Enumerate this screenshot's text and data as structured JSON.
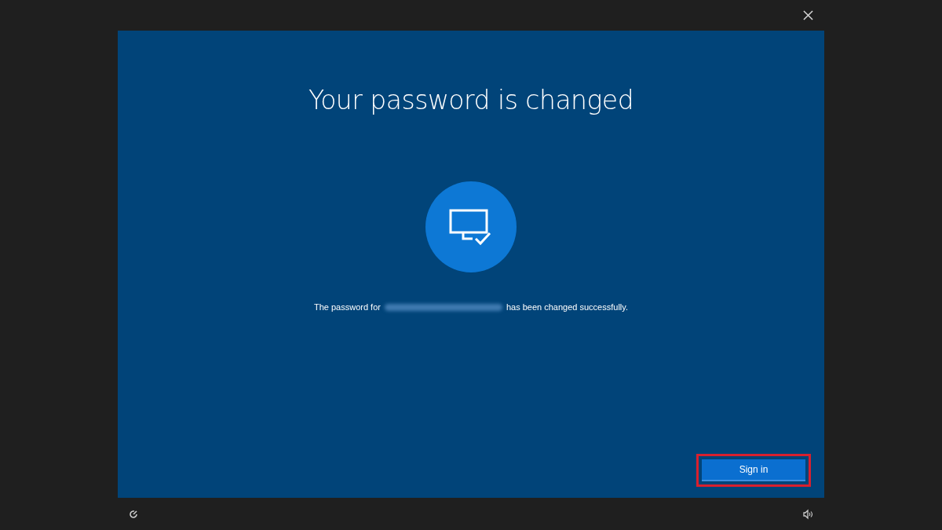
{
  "dialog": {
    "title": "Your password is changed",
    "message": {
      "before": "The password for",
      "redacted": true,
      "after": "has been changed successfully."
    },
    "sign_in_button": {
      "label": "Sign in",
      "highlighted": true
    }
  }
}
